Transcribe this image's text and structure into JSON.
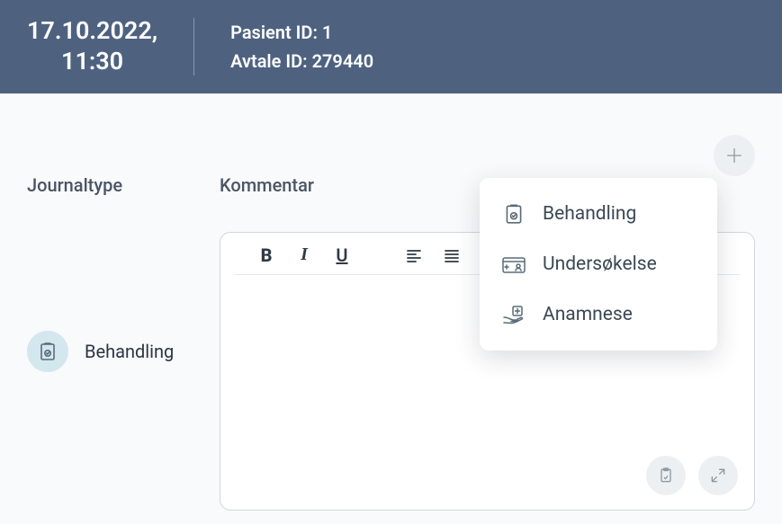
{
  "header": {
    "date": "17.10.2022,",
    "time": "11:30",
    "patient_label": "Pasient ID:",
    "patient_id": "1",
    "appointment_label": "Avtale ID:",
    "appointment_id": "279440"
  },
  "labels": {
    "journal_type": "Journaltype",
    "comment": "Kommentar"
  },
  "journal_type": {
    "selected": "Behandling"
  },
  "dropdown": {
    "items": [
      {
        "label": "Behandling",
        "icon": "clipboard-check-icon"
      },
      {
        "label": "Undersøkelse",
        "icon": "id-card-icon"
      },
      {
        "label": "Anamnese",
        "icon": "hand-medical-icon"
      }
    ]
  },
  "toolbar": {
    "bold": "B",
    "italic": "I",
    "underline": "U"
  }
}
